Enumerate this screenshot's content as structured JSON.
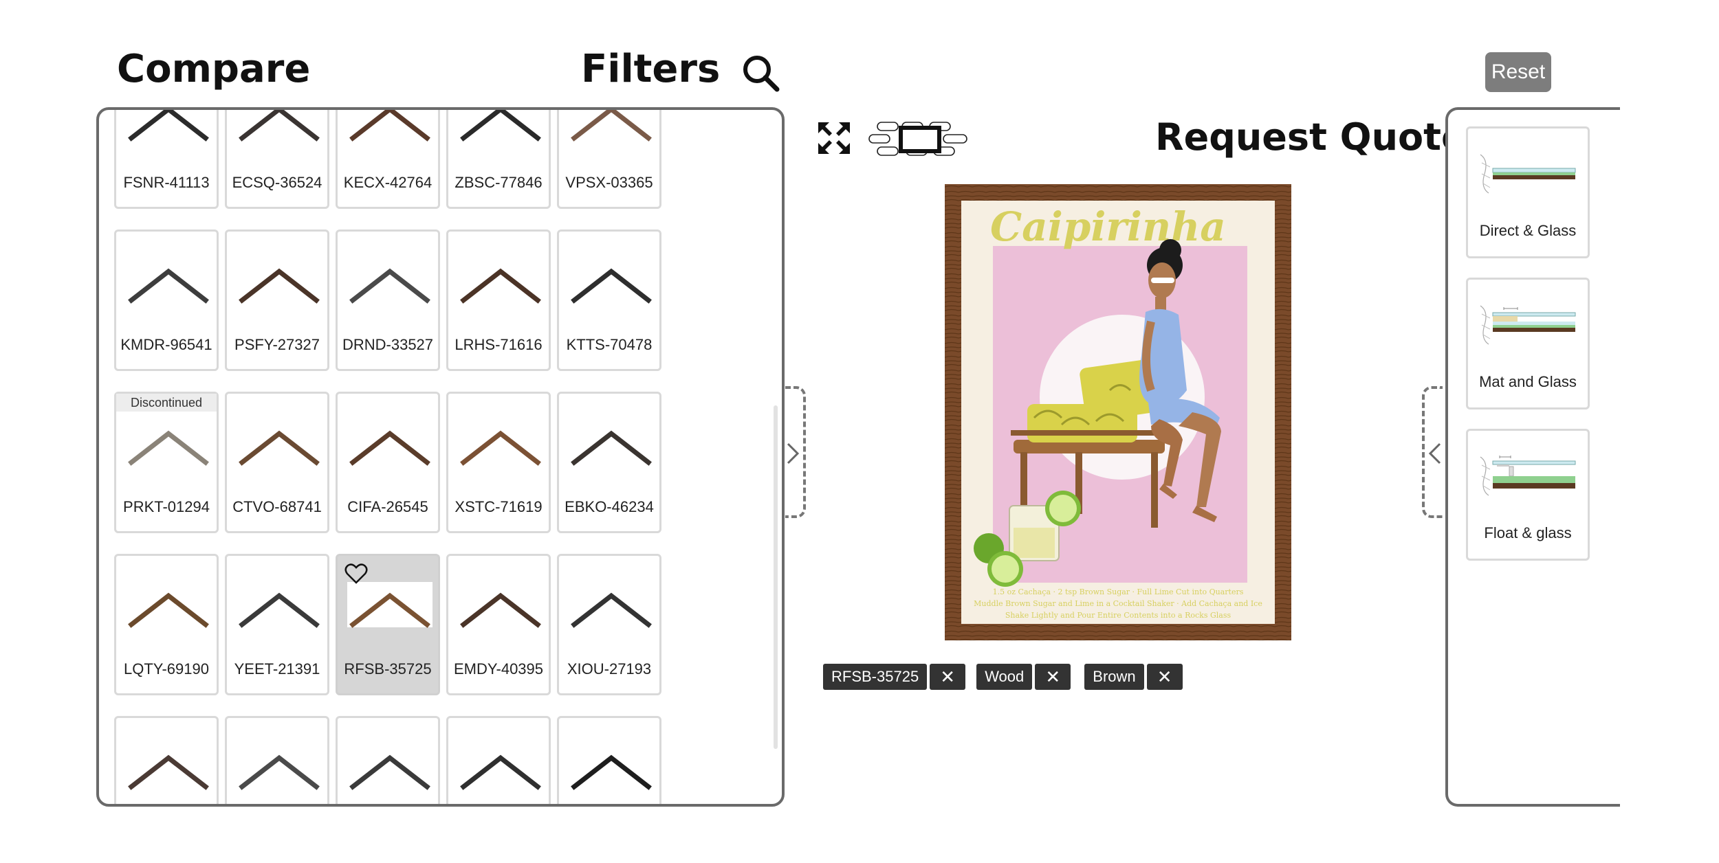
{
  "header": {
    "compare_label": "Compare",
    "filters_label": "Filters",
    "reset_label": "Reset"
  },
  "tiles": [
    {
      "code": "FSNR-41113",
      "color": "#2b2b2b"
    },
    {
      "code": "ECSQ-36524",
      "color": "#3a3432"
    },
    {
      "code": "KECX-42764",
      "color": "#5a3a2a"
    },
    {
      "code": "ZBSC-77846",
      "color": "#2a2a2a"
    },
    {
      "code": "VPSX-03365",
      "color": "#7a5a48"
    },
    {
      "code": "KMDR-96541",
      "color": "#3d3d3d"
    },
    {
      "code": "PSFY-27327",
      "color": "#4a3428"
    },
    {
      "code": "DRND-33527",
      "color": "#4a4a4a"
    },
    {
      "code": "LRHS-71616",
      "color": "#4b3326"
    },
    {
      "code": "KTTS-70478",
      "color": "#2e2e2e"
    },
    {
      "code": "PRKT-01294",
      "color": "#8a8378",
      "badge": "Discontinued"
    },
    {
      "code": "CTVO-68741",
      "color": "#6a4a32"
    },
    {
      "code": "CIFA-26545",
      "color": "#5a3c2a"
    },
    {
      "code": "XSTC-71619",
      "color": "#7b5134"
    },
    {
      "code": "EBKO-46234",
      "color": "#3a3430"
    },
    {
      "code": "LQTY-69190",
      "color": "#6b4a2c"
    },
    {
      "code": "YEET-21391",
      "color": "#3a3a3a"
    },
    {
      "code": "RFSB-35725",
      "color": "#7a5232",
      "selected": true
    },
    {
      "code": "EMDY-40395",
      "color": "#4a3428"
    },
    {
      "code": "XIOU-27193",
      "color": "#333333"
    },
    {
      "code": "",
      "color": "#4a3a34"
    },
    {
      "code": "",
      "color": "#4a4a4a"
    },
    {
      "code": "",
      "color": "#3a3a3a"
    },
    {
      "code": "",
      "color": "#2f2f2f"
    },
    {
      "code": "",
      "color": "#1e1e1e"
    }
  ],
  "center": {
    "request_quote_label": "Request Quote",
    "poster": {
      "title": "Caipirinha",
      "recipe_lines": [
        "1.5 oz Cachaça · 2 tsp Brown Sugar · Full Lime Cut into Quarters",
        "Muddle Brown Sugar and Lime in a Cocktail Shaker · Add Cachaça and Ice",
        "Shake Lightly and Pour Entire Contents into a Rocks Glass"
      ]
    },
    "tags": [
      {
        "label": "RFSB-35725"
      },
      {
        "label": "Wood"
      },
      {
        "label": "Brown"
      }
    ],
    "remove_glyph": "✕"
  },
  "mounts": [
    {
      "label": "Direct & Glass"
    },
    {
      "label": "Mat and Glass"
    },
    {
      "label": "Float & glass"
    }
  ]
}
